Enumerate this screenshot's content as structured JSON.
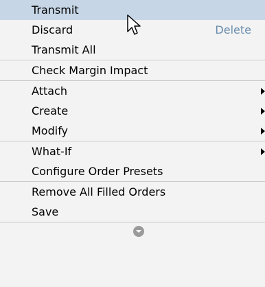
{
  "menu": {
    "groups": [
      {
        "items": [
          {
            "label": "Transmit",
            "highlighted": true
          },
          {
            "label": "Discard",
            "shortcut": "Delete"
          },
          {
            "label": "Transmit All"
          }
        ]
      },
      {
        "items": [
          {
            "label": "Check Margin Impact"
          }
        ]
      },
      {
        "items": [
          {
            "label": "Attach",
            "submenu": true
          },
          {
            "label": "Create",
            "submenu": true
          },
          {
            "label": "Modify",
            "submenu": true
          }
        ]
      },
      {
        "items": [
          {
            "label": "What-If",
            "submenu": true
          },
          {
            "label": "Configure Order Presets"
          }
        ]
      },
      {
        "items": [
          {
            "label": "Remove All Filled Orders"
          },
          {
            "label": "Save"
          }
        ]
      }
    ],
    "more_icon": "chevron-down-circle-icon",
    "cursor_icon": "mouse-pointer-icon"
  },
  "colors": {
    "menu_background": "#f3f3f3",
    "highlight": "#c6d6e6",
    "shortcut_text": "#6a8cad",
    "separator": "#c8c8c8"
  }
}
